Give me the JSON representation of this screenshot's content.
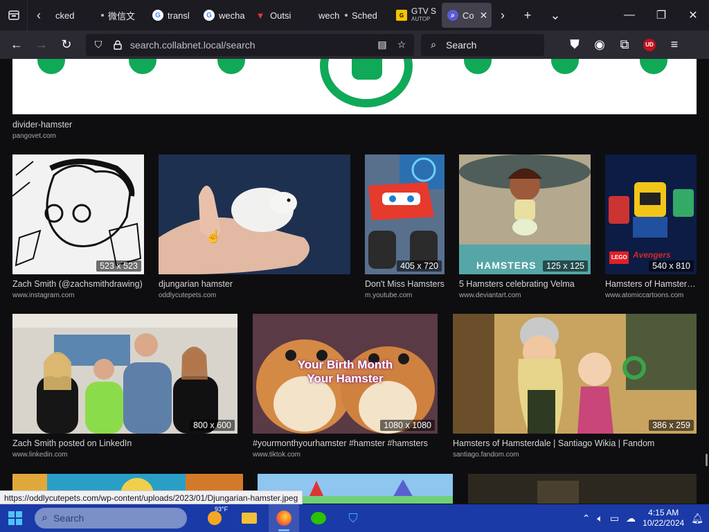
{
  "window": {
    "tabs": [
      {
        "label": "cked",
        "icon": "none"
      },
      {
        "label": "微信文",
        "icon": "dot"
      },
      {
        "label": "transl",
        "icon": "google"
      },
      {
        "label": "wecha",
        "icon": "google"
      },
      {
        "label": "Outsi",
        "icon": "red-logo"
      },
      {
        "label": "wecha",
        "icon": "none"
      },
      {
        "label": "Sched",
        "icon": "dot"
      },
      {
        "label": "GTV S",
        "sublabel": "AUTOP",
        "icon": "gtv"
      },
      {
        "label": "Co",
        "icon": "collabnet",
        "active": true
      }
    ],
    "new_tab_symbol": "+",
    "tab_list_symbol": "⌄"
  },
  "navbar": {
    "url": "search.collabnet.local/search",
    "search_placeholder": "Search",
    "ext_badge": "UD"
  },
  "results": {
    "banner": {
      "title": "divider-hamster",
      "source": "pangovet.com"
    },
    "row1": [
      {
        "title": "Zach Smith (@zachsmithdrawing)",
        "source": "www.instagram.com",
        "dims": "523 x 523"
      },
      {
        "title": "djungarian hamster",
        "source": "oddlycutepets.com",
        "dims": ""
      },
      {
        "title": "Don't Miss Hamsters",
        "source": "m.youtube.com",
        "dims": "405 x 720"
      },
      {
        "title": "5 Hamsters celebrating Velma",
        "source": "www.deviantart.com",
        "dims": "125 x 125"
      },
      {
        "title": "Hamsters of Hamsterdale",
        "source": "www.atomiccartoons.com",
        "dims": "540 x 810"
      }
    ],
    "row2": [
      {
        "title": "Zach Smith posted on LinkedIn",
        "source": "www.linkedin.com",
        "dims": "800 x 600"
      },
      {
        "title": "#yourmonthyourhamster #hamster #hamsters",
        "source": "www.tiktok.com",
        "dims": "1080 x 1080",
        "overlay": "Your Birth Month Your Hamster"
      },
      {
        "title": "Hamsters of Hamsterdale | Santiago Wikia | Fandom",
        "source": "santiago.fandom.com",
        "dims": "386 x 259"
      }
    ],
    "art_text": {
      "hamsters_sign": "HAMSTERS",
      "lego_brand": "LEGO",
      "avengers": "Avengers"
    }
  },
  "status_url": "https://oddlycutepets.com/wp-content/uploads/2023/01/Djungarian-hamster.jpeg",
  "taskbar": {
    "search_placeholder": "Search",
    "weather": "93°F",
    "time": "4:15 AM",
    "date": "10/22/2024"
  },
  "colors": {
    "accent_green": "#10a957",
    "taskbar_blue": "#1a3aa8",
    "tab_active": "#42414d"
  }
}
